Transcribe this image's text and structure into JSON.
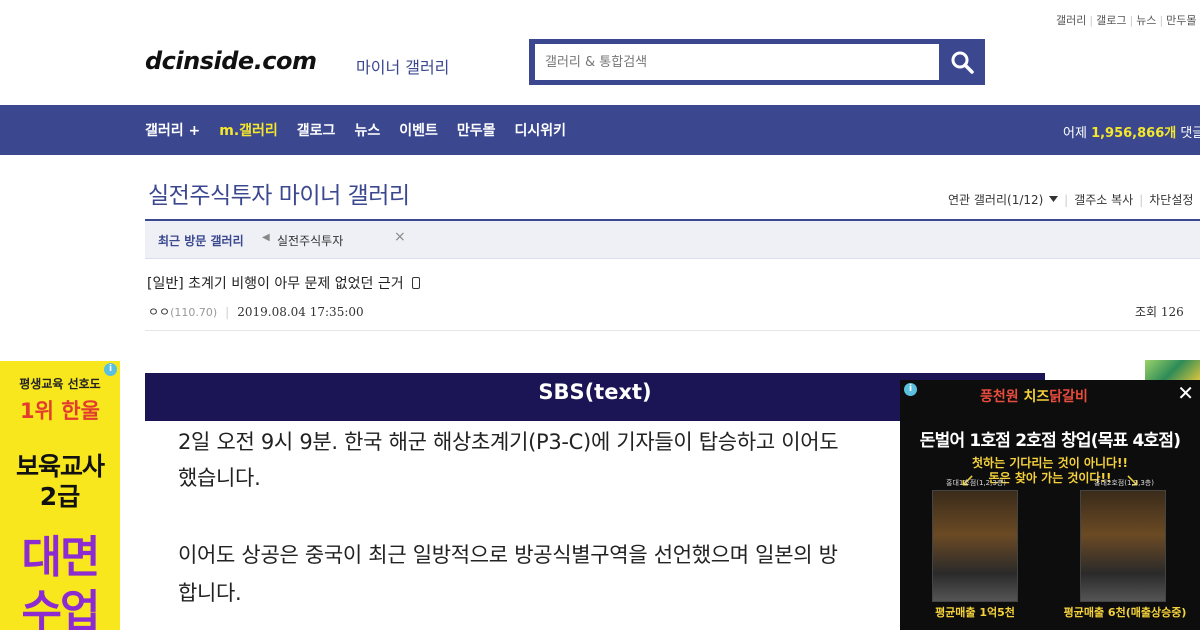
{
  "top_links": [
    "갤러리",
    "갤로그",
    "뉴스",
    "만두몰"
  ],
  "logo": {
    "text": "dcinside.com",
    "subtitle": "마이너 갤러리"
  },
  "search": {
    "placeholder": "갤러리 & 통합검색",
    "icon": "search-icon"
  },
  "nav": {
    "items": [
      "갤러리 +",
      "m.갤러리",
      "갤로그",
      "뉴스",
      "이벤트",
      "만두몰",
      "디시위키"
    ],
    "highlight_index": 1,
    "stats_prefix": "어제 ",
    "stats_value": "1,956,866개",
    "stats_suffix": " 댓글"
  },
  "gallery": {
    "title": "실전주식투자 마이너 갤러리",
    "tools": [
      "연관 갤러리(1/12)",
      "갤주소 복사",
      "차단설정"
    ]
  },
  "recent": {
    "label": "최근 방문 갤러리",
    "items": [
      "실전주식투자"
    ]
  },
  "post": {
    "title": "[일반] 초계기 비행이 아무 문제 없었던 근거",
    "author": "ㅇㅇ",
    "ip": "(110.70)",
    "date": "2019.08.04 17:35:00",
    "views": "조회 126"
  },
  "content": {
    "banner": "SBS(text)",
    "paragraphs": [
      "2일 오전 9시 9분. 한국 해군 해상초계기(P3-C)에 기자들이 탑승하고 이어도",
      "했습니다.",
      "이어도 상공은 중국이 최근 일방적으로 방공식별구역을 선언했으며 일본의 방",
      "합니다."
    ]
  },
  "ad_left": {
    "lines": [
      "평생교육 선호도",
      "1위 한울",
      "보육교사",
      "2급",
      "대면",
      "수업"
    ]
  },
  "ad_right": {
    "brand_a": "풍천원",
    "brand_b": " 치즈",
    "brand_c": "닭갈비",
    "headline": "돈벌어 1호점 2호점 창업(목표 4호점)",
    "slogan_1": "첫하는 기다리는 것이 아니다!!",
    "slogan_2": "돈은 찾아 가는 것이다!!",
    "shop_1_caption": "홍대1호점(1,2,3층)",
    "shop_2_caption": "홍대2호점(1,2,3층)",
    "revenue_1": "평균매출 1억5천",
    "revenue_2": "평균매출 6천(매출상승중)"
  },
  "colors": {
    "brand": "#3b4890",
    "highlight": "#f5e72b",
    "banner": "#1c1555"
  }
}
